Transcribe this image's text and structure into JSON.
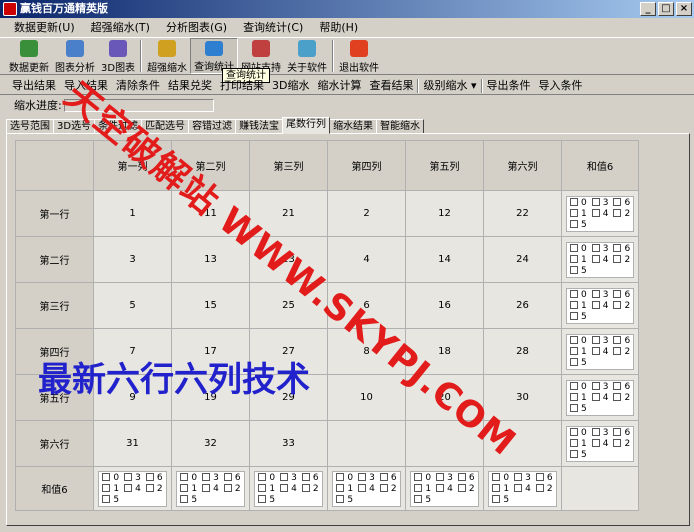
{
  "window": {
    "title": "赢钱百万通精英版"
  },
  "menu": [
    "数据更新(U)",
    "超强缩水(T)",
    "分析图表(G)",
    "查询统计(C)",
    "帮助(H)"
  ],
  "toolbar": [
    {
      "label": "数据更新",
      "icon": "data-update-icon",
      "color": "#3a8f3a"
    },
    {
      "label": "图表分析",
      "icon": "chart-icon",
      "color": "#4a7fc9"
    },
    {
      "label": "3D图表",
      "icon": "3d-chart-icon",
      "color": "#6a58b8"
    },
    {
      "label": "超强缩水",
      "icon": "filter-icon",
      "color": "#d0a020"
    },
    {
      "label": "查询统计",
      "icon": "query-icon",
      "color": "#2e7fd0"
    },
    {
      "label": "网站支持",
      "icon": "home-icon",
      "color": "#c04040"
    },
    {
      "label": "关于软件",
      "icon": "about-icon",
      "color": "#4aa0c8"
    },
    {
      "label": "退出软件",
      "icon": "exit-icon",
      "color": "#e04020"
    }
  ],
  "tooltip": "查询统计",
  "commands": [
    "导出结果",
    "导入结果",
    "清除条件",
    "结果兑奖",
    "打印结果",
    "3D缩水",
    "缩水计算",
    "查看结果",
    "级别缩水 ▾",
    "导出条件",
    "导入条件"
  ],
  "progress_label": "缩水进度:",
  "tabs": [
    "选号范围",
    "3D选号",
    "条件过滤",
    "匹配选号",
    "容错过滤",
    "赚钱法宝",
    "尾数行列",
    "缩水结果",
    "智能缩水"
  ],
  "active_tab": 6,
  "grid": {
    "columns": [
      "第一列",
      "第二列",
      "第三列",
      "第四列",
      "第五列",
      "第六列",
      "和值6"
    ],
    "rows": [
      {
        "label": "第一行",
        "values": [
          "1",
          "11",
          "21",
          "2",
          "12",
          "22"
        ]
      },
      {
        "label": "第二行",
        "values": [
          "3",
          "13",
          "23",
          "4",
          "14",
          "24"
        ]
      },
      {
        "label": "第三行",
        "values": [
          "5",
          "15",
          "25",
          "6",
          "16",
          "26"
        ]
      },
      {
        "label": "第四行",
        "values": [
          "7",
          "17",
          "27",
          "8",
          "18",
          "28"
        ]
      },
      {
        "label": "第五行",
        "values": [
          "9",
          "19",
          "29",
          "10",
          "20",
          "30"
        ]
      },
      {
        "label": "第六行",
        "values": [
          "31",
          "32",
          "33",
          "",
          "",
          ""
        ]
      }
    ],
    "sum_row_label": "和值6",
    "checkbox_options": [
      "0",
      "3",
      "6",
      "1",
      "4",
      "2",
      "5"
    ]
  },
  "watermark": {
    "line1": "天空破解站 WWW.SKYPJ.COM",
    "line2": "最新六行六列技术"
  }
}
